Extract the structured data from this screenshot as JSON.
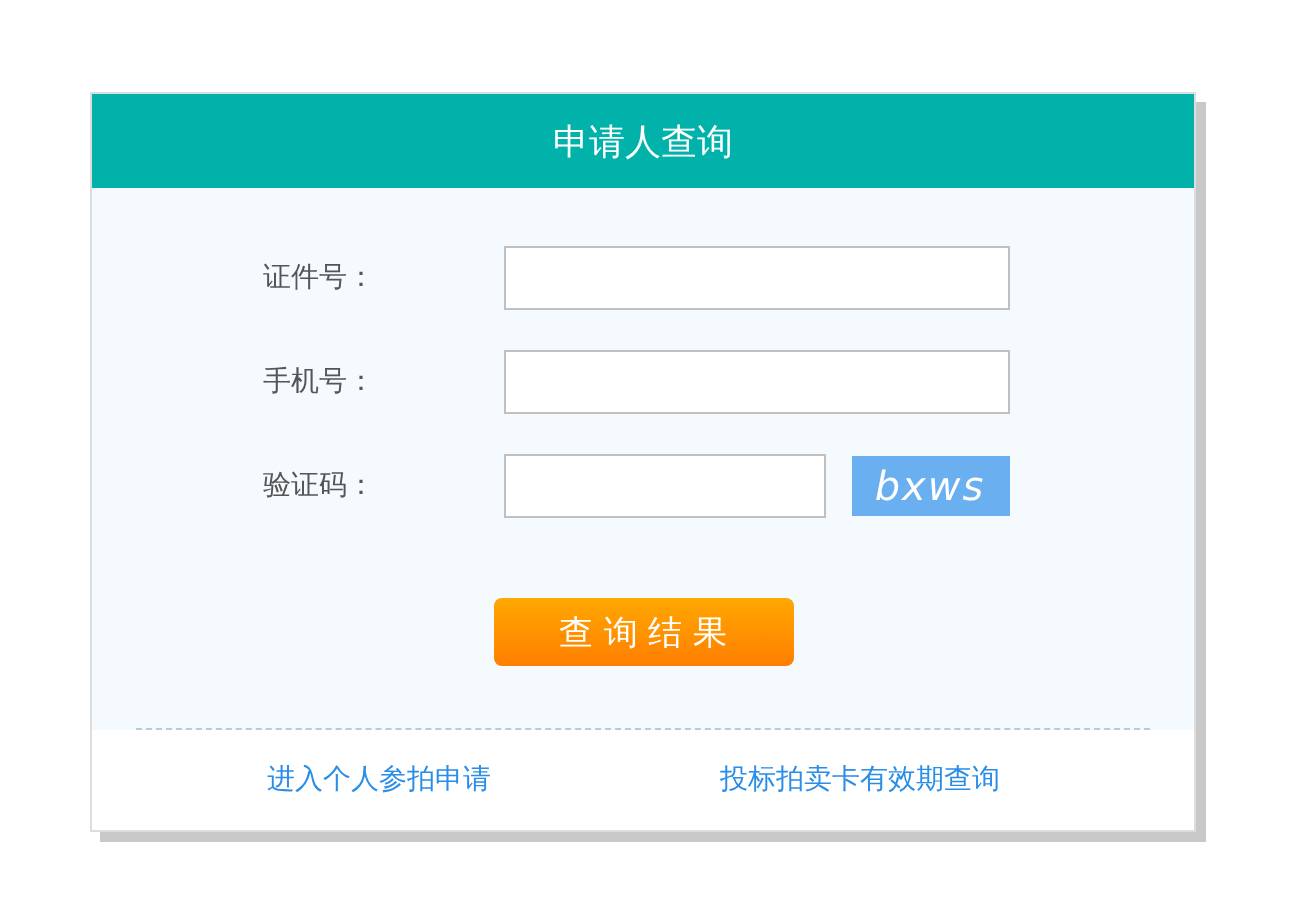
{
  "title": "申请人查询",
  "fields": [
    {
      "label": "证件号：",
      "kind": "text"
    },
    {
      "label": "手机号：",
      "kind": "text"
    },
    {
      "label": "验证码：",
      "kind": "captcha",
      "captcha": "bxws"
    }
  ],
  "submit": "查 询 结 果",
  "links": [
    "进入个人参拍申请",
    "投标拍卖卡有效期查询"
  ]
}
